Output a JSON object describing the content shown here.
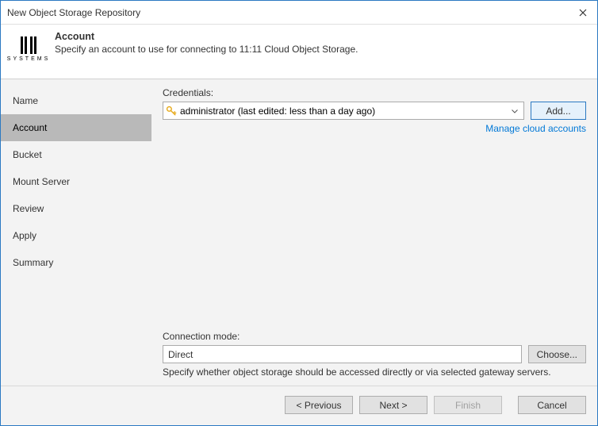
{
  "window": {
    "title": "New Object Storage Repository"
  },
  "header": {
    "logo_text": "SYSTEMS",
    "title": "Account",
    "subtitle": "Specify an account to use for connecting to 11:11 Cloud Object Storage."
  },
  "sidebar": {
    "items": [
      {
        "label": "Name"
      },
      {
        "label": "Account"
      },
      {
        "label": "Bucket"
      },
      {
        "label": "Mount Server"
      },
      {
        "label": "Review"
      },
      {
        "label": "Apply"
      },
      {
        "label": "Summary"
      }
    ],
    "active": 1
  },
  "main": {
    "credentials_label": "Credentials:",
    "credentials_value": "administrator (last edited: less than a day ago)",
    "add_button": "Add...",
    "manage_link": "Manage cloud accounts",
    "connection_label": "Connection mode:",
    "connection_value": "Direct",
    "choose_button": "Choose...",
    "connection_hint": "Specify whether object storage should be accessed directly or via selected gateway servers."
  },
  "footer": {
    "previous": "< Previous",
    "next": "Next >",
    "finish": "Finish",
    "cancel": "Cancel"
  }
}
